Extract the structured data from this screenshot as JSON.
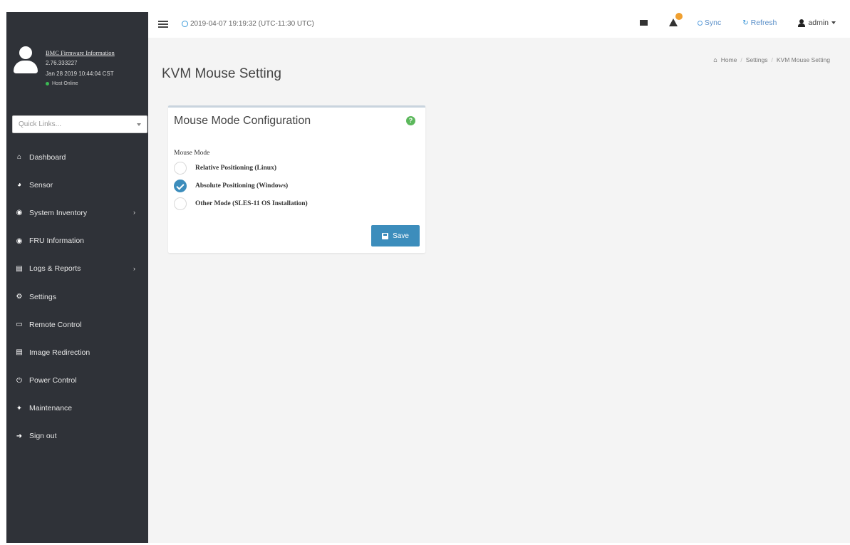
{
  "topbar": {
    "datetime": "2019-04-07 19:19:32 (UTC-11:30 UTC)",
    "sync_label": "Sync",
    "refresh_label": "Refresh",
    "user_label": "admin"
  },
  "sidebar": {
    "firmware_title": "BMC Firmware Information",
    "firmware_version": "2.76.333227",
    "firmware_date": "Jan 28 2019 10:44:04 CST",
    "host_status": "Host Online",
    "quicklinks_placeholder": "Quick Links...",
    "items": [
      {
        "label": "Dashboard",
        "icon": "dashboard-icon",
        "has_children": false
      },
      {
        "label": "Sensor",
        "icon": "sensor-icon",
        "has_children": false
      },
      {
        "label": "System Inventory",
        "icon": "system-inventory-icon",
        "has_children": true
      },
      {
        "label": "FRU Information",
        "icon": "fru-icon",
        "has_children": false
      },
      {
        "label": "Logs & Reports",
        "icon": "logs-icon",
        "has_children": true
      },
      {
        "label": "Settings",
        "icon": "settings-icon",
        "has_children": false
      },
      {
        "label": "Remote Control",
        "icon": "remote-control-icon",
        "has_children": false
      },
      {
        "label": "Image Redirection",
        "icon": "image-redirection-icon",
        "has_children": false
      },
      {
        "label": "Power Control",
        "icon": "power-icon",
        "has_children": false
      },
      {
        "label": "Maintenance",
        "icon": "maintenance-icon",
        "has_children": false
      },
      {
        "label": "Sign out",
        "icon": "sign-out-icon",
        "has_children": false
      }
    ]
  },
  "page": {
    "title": "KVM Mouse Setting",
    "breadcrumb": [
      "Home",
      "Settings",
      "KVM Mouse Setting"
    ]
  },
  "box": {
    "title": "Mouse Mode Configuration",
    "field_label": "Mouse Mode",
    "options": [
      {
        "label": "Relative Positioning (Linux)",
        "checked": false
      },
      {
        "label": "Absolute Positioning (Windows)",
        "checked": true
      },
      {
        "label": "Other Mode (SLES-11 OS Installation)",
        "checked": false
      }
    ],
    "save_label": "Save"
  },
  "colors": {
    "sidebar_bg": "#2f3238",
    "accent": "#3c8dbc",
    "help_green": "#5cb85c",
    "alert_badge": "#f0a030"
  }
}
